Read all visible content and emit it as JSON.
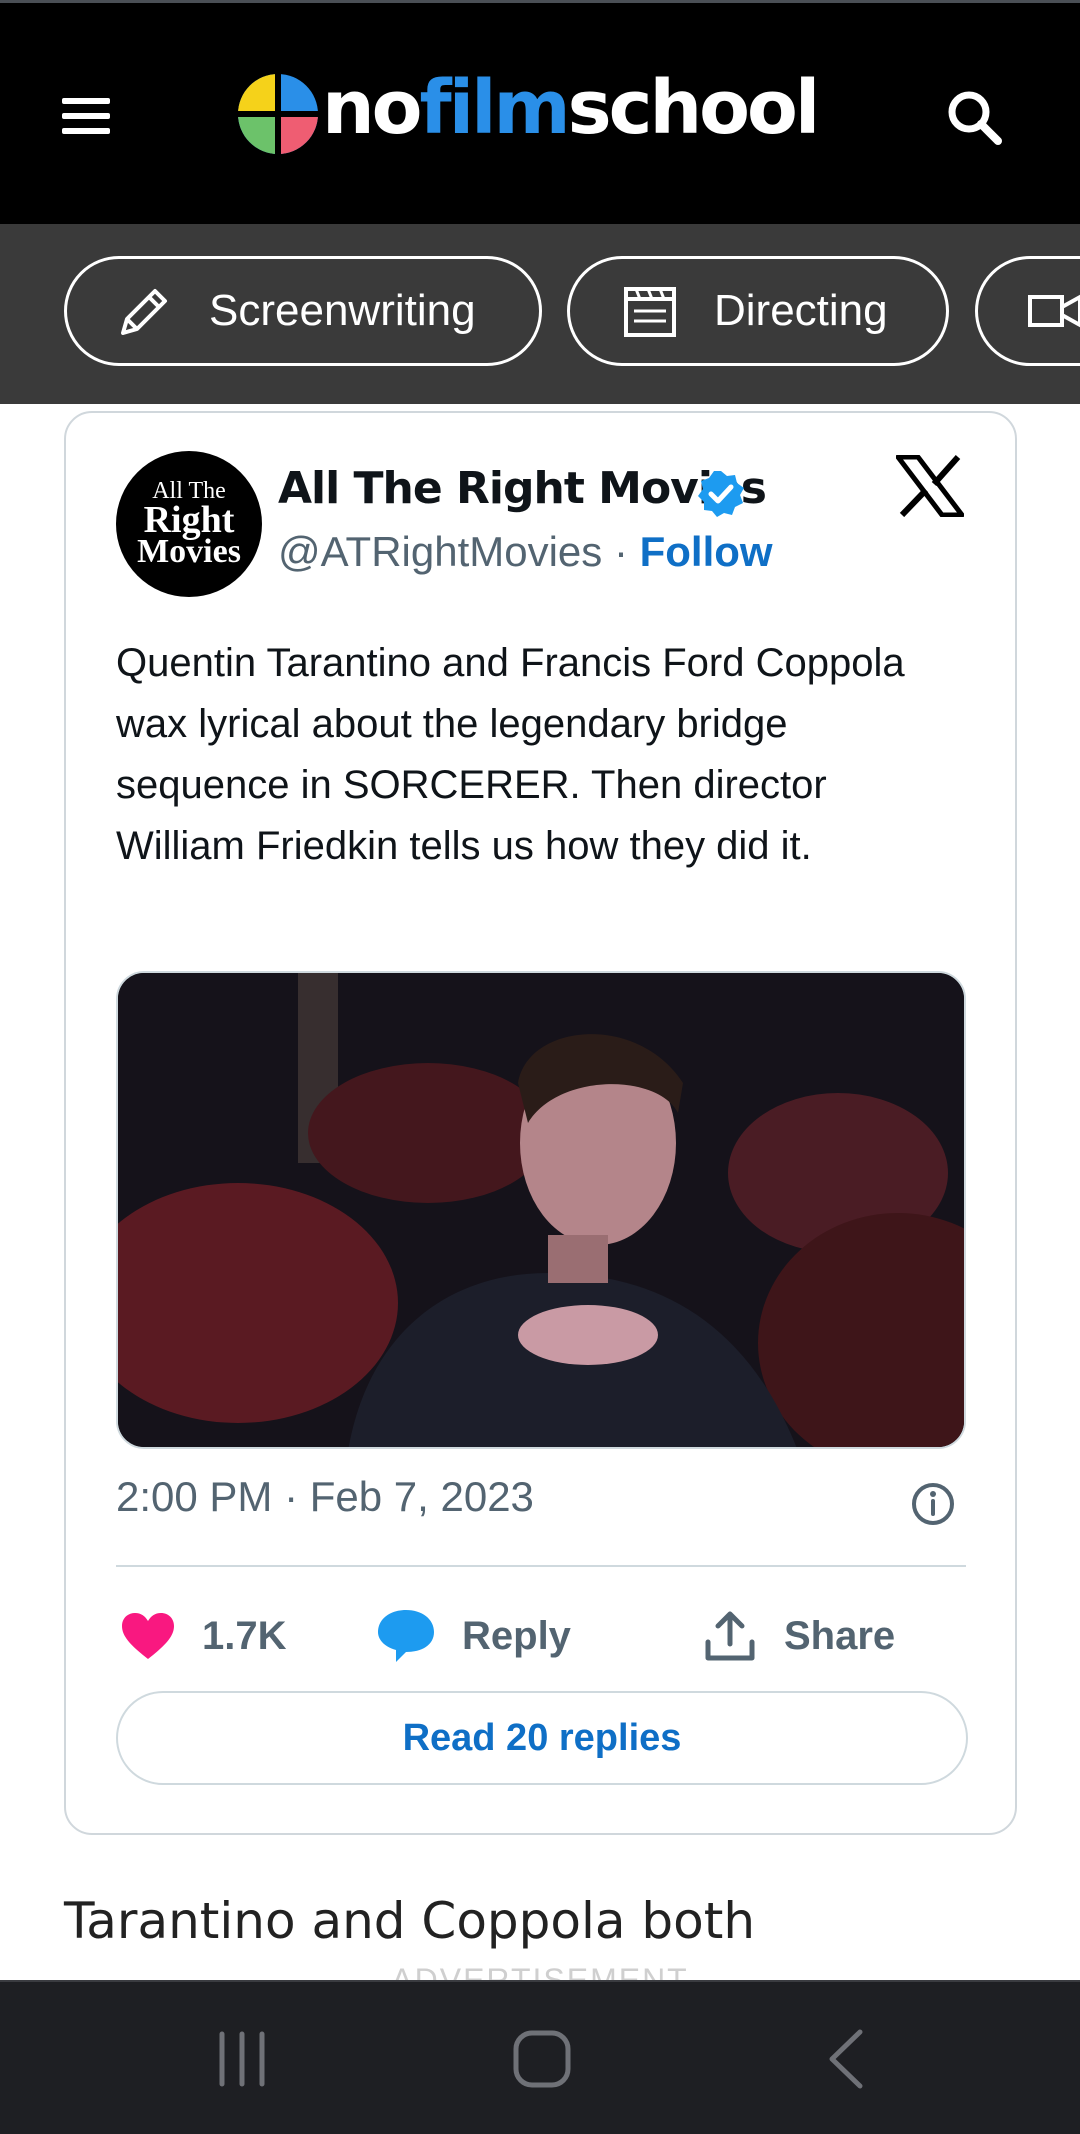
{
  "header": {
    "logo": {
      "no": "no",
      "film": "film",
      "school": "school"
    },
    "menu_icon": "hamburger-menu-icon",
    "search_icon": "search-icon"
  },
  "categories": [
    {
      "label": "Screenwriting",
      "icon": "pencil-icon"
    },
    {
      "label": "Directing",
      "icon": "clapperboard-icon"
    },
    {
      "label": "",
      "icon": "video-camera-icon"
    }
  ],
  "tweet": {
    "avatar_text": {
      "line1": "All The",
      "line2": "Right",
      "line3": "Movies"
    },
    "author_name": "All The Right Movies",
    "handle": "@ATRightMovies",
    "separator": "·",
    "follow_label": "Follow",
    "text": "Quentin Tarantino and Francis Ford Coppola wax lyrical about the legendary bridge sequence in SORCERER. Then director William Friedkin tells us how they did it.",
    "timestamp": "2:00 PM · Feb 7, 2023",
    "likes": "1.7K",
    "reply_label": "Reply",
    "share_label": "Share",
    "read_replies": "Read 20 replies",
    "colors": {
      "like": "#f91880",
      "reply": "#1d9bf0",
      "verified": "#1d9bf0",
      "link": "#0f6fc6"
    }
  },
  "article": {
    "text": "Tarantino and Coppola both",
    "ad_label": "ADVERTISEMENT"
  },
  "navbar": {
    "recent_icon": "recent-apps-icon",
    "home_icon": "home-icon",
    "back_icon": "back-icon"
  }
}
